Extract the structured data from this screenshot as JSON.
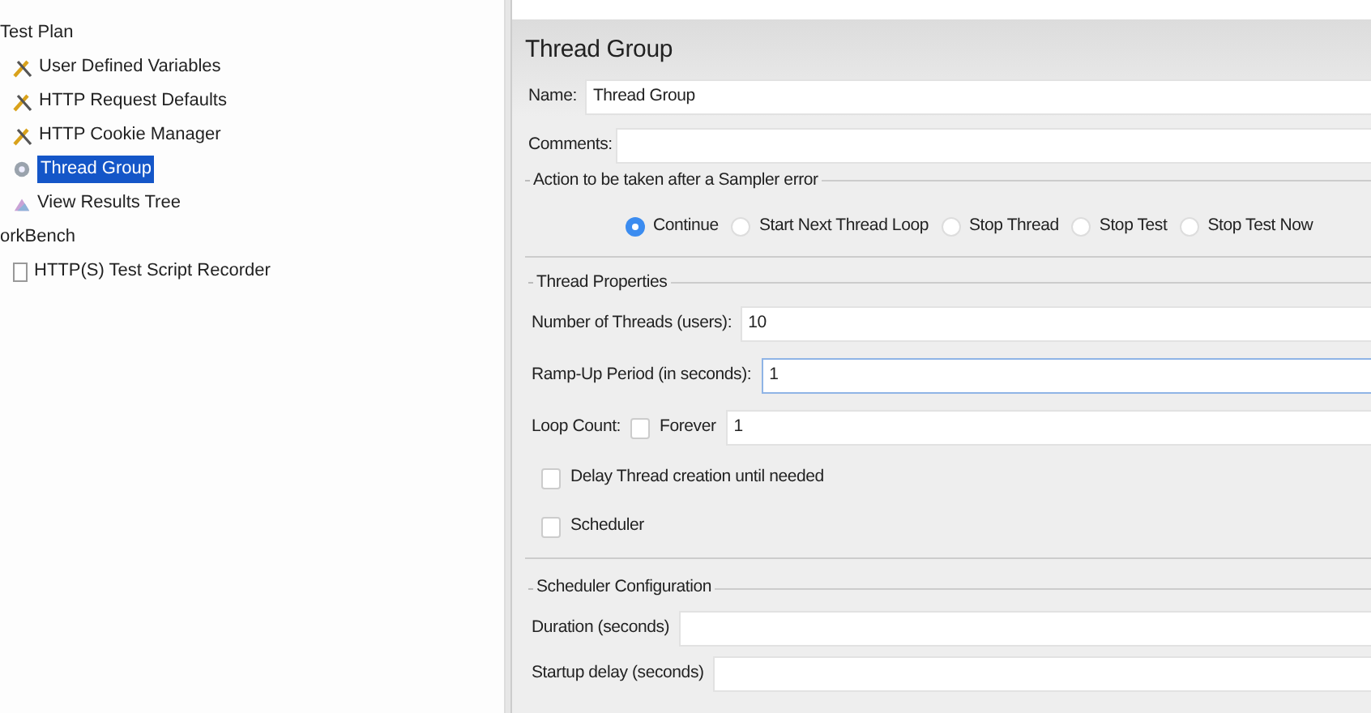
{
  "tree": [
    {
      "label": "Test Plan",
      "selected": false,
      "children": [
        {
          "label": "User Defined Variables",
          "kind": "config",
          "selected": false
        },
        {
          "label": "HTTP Request Defaults",
          "kind": "config",
          "selected": false
        },
        {
          "label": "HTTP Cookie Manager",
          "kind": "config",
          "selected": false
        },
        {
          "label": "Thread Group",
          "kind": "threads",
          "selected": true
        },
        {
          "label": "View Results Tree",
          "kind": "listener",
          "selected": false
        }
      ]
    },
    {
      "label": "orkBench",
      "selected": false,
      "children": [
        {
          "label": "HTTP(S) Test Script Recorder",
          "kind": "recorder",
          "selected": false
        }
      ]
    }
  ],
  "panel": {
    "title": "Thread Group",
    "name": {
      "label": "Name:",
      "value": "Thread Group"
    },
    "comments": {
      "label": "Comments:"
    },
    "error_action": {
      "legend": "Action to be taken after a Sampler error",
      "options": [
        {
          "label": "Continue",
          "selected": true
        },
        {
          "label": "Start Next Thread Loop",
          "selected": false
        },
        {
          "label": "Stop Thread",
          "selected": false
        },
        {
          "label": "Stop Test",
          "selected": false
        },
        {
          "label": "Stop Test Now",
          "selected": false
        }
      ]
    },
    "thread_properties": {
      "legend": "Thread Properties",
      "threads": {
        "label": "Number of Threads (users):",
        "value": "10"
      },
      "ramp_up": {
        "label": "Ramp-Up Period (in seconds):",
        "value": "1",
        "focused": true
      },
      "loop_count": {
        "label": "Loop Count:",
        "forever": {
          "label": "Forever",
          "checked": false
        },
        "value": "1"
      },
      "delay": {
        "label": "Delay Thread creation until needed",
        "checked": false
      },
      "scheduler": {
        "label": "Scheduler",
        "checked": false
      }
    },
    "scheduler_config": {
      "legend": "Scheduler Configuration",
      "duration": {
        "label": "Duration (seconds)"
      },
      "startup_delay": {
        "label": "Startup delay (seconds)"
      }
    }
  }
}
